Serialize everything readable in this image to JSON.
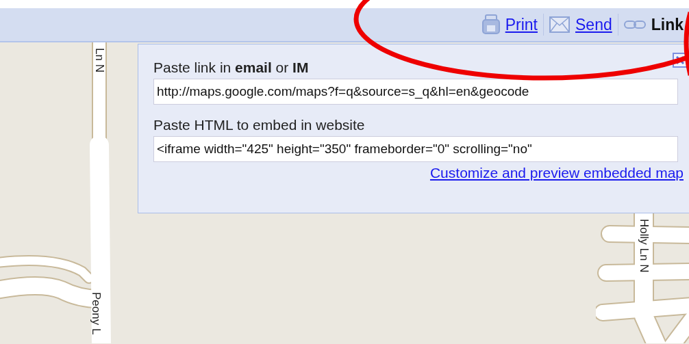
{
  "toolbar": {
    "actions": [
      {
        "label": "Print",
        "kind": "link"
      },
      {
        "label": "Send",
        "kind": "link"
      },
      {
        "label": "Link",
        "kind": "current"
      }
    ]
  },
  "link_panel": {
    "fields": [
      {
        "label": "Paste link in **email** or **IM**",
        "value": "http://maps.google.com/maps?f=q&source=s_q&hl=en&geocode"
      },
      {
        "label": "Paste HTML to embed in website",
        "value": "<iframe width=\"425\" height=\"350\" frameborder=\"0\" scrolling=\"no\""
      }
    ],
    "link": "Customize and preview embedded map"
  },
  "map": {
    "street_labels": [
      {
        "name": "Ln N"
      },
      {
        "name": "Peony L"
      },
      {
        "name": "Holly Ln N"
      }
    ]
  }
}
